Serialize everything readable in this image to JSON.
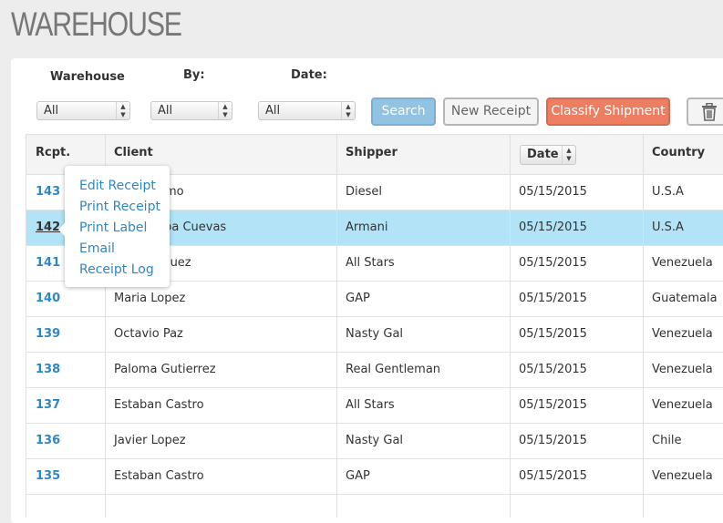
{
  "page": {
    "title": "WAREHOUSE"
  },
  "filters": {
    "warehouse_label": "Warehouse",
    "by_label": "By:",
    "date_label": "Date:",
    "warehouse_value": "All",
    "by_value": "All",
    "date_value": "All"
  },
  "toolbar": {
    "search_label": "Search",
    "new_receipt_label": "New Receipt",
    "classify_label": "Classify Shipment",
    "trash_icon": "trash-icon"
  },
  "table": {
    "headers": {
      "rcpt": "Rcpt.",
      "client": "Client",
      "shipper": "Shipper",
      "date": "Date",
      "country": "Country"
    },
    "rows": [
      {
        "rcpt": "143",
        "client": "Ana Palomo",
        "shipper": "Diesel",
        "date": "05/15/2015",
        "country": "U.S.A"
      },
      {
        "rcpt": "142",
        "client": "Luis Ochoa Cuevas",
        "shipper": "Armani",
        "date": "05/15/2015",
        "country": "U.S.A",
        "selected": true
      },
      {
        "rcpt": "141",
        "client": "Jose Vasquez",
        "shipper": "All Stars",
        "date": "05/15/2015",
        "country": "Venezuela"
      },
      {
        "rcpt": "140",
        "client": "Maria Lopez",
        "shipper": "GAP",
        "date": "05/15/2015",
        "country": "Guatemala"
      },
      {
        "rcpt": "139",
        "client": "Octavio Paz",
        "shipper": "Nasty Gal",
        "date": "05/15/2015",
        "country": "Venezuela"
      },
      {
        "rcpt": "138",
        "client": "Paloma Gutierrez",
        "shipper": "Real Gentleman",
        "date": "05/15/2015",
        "country": "Venezuela"
      },
      {
        "rcpt": "137",
        "client": "Estaban Castro",
        "shipper": "All Stars",
        "date": "05/15/2015",
        "country": "Venezuela"
      },
      {
        "rcpt": "136",
        "client": "Javier Lopez",
        "shipper": "Nasty Gal",
        "date": "05/15/2015",
        "country": "Chile"
      },
      {
        "rcpt": "135",
        "client": "Estaban Castro",
        "shipper": "GAP",
        "date": "05/15/2015",
        "country": "Venezuela"
      }
    ]
  },
  "context_menu": {
    "items": [
      "Edit Receipt",
      "Print Receipt",
      "Print Label",
      "Email",
      "Receipt Log"
    ]
  },
  "colors": {
    "accent_blue": "#2f87c4",
    "selected_row": "#b2e3f7",
    "classify_button": "#ed7e62",
    "search_button": "#93c3e3"
  }
}
